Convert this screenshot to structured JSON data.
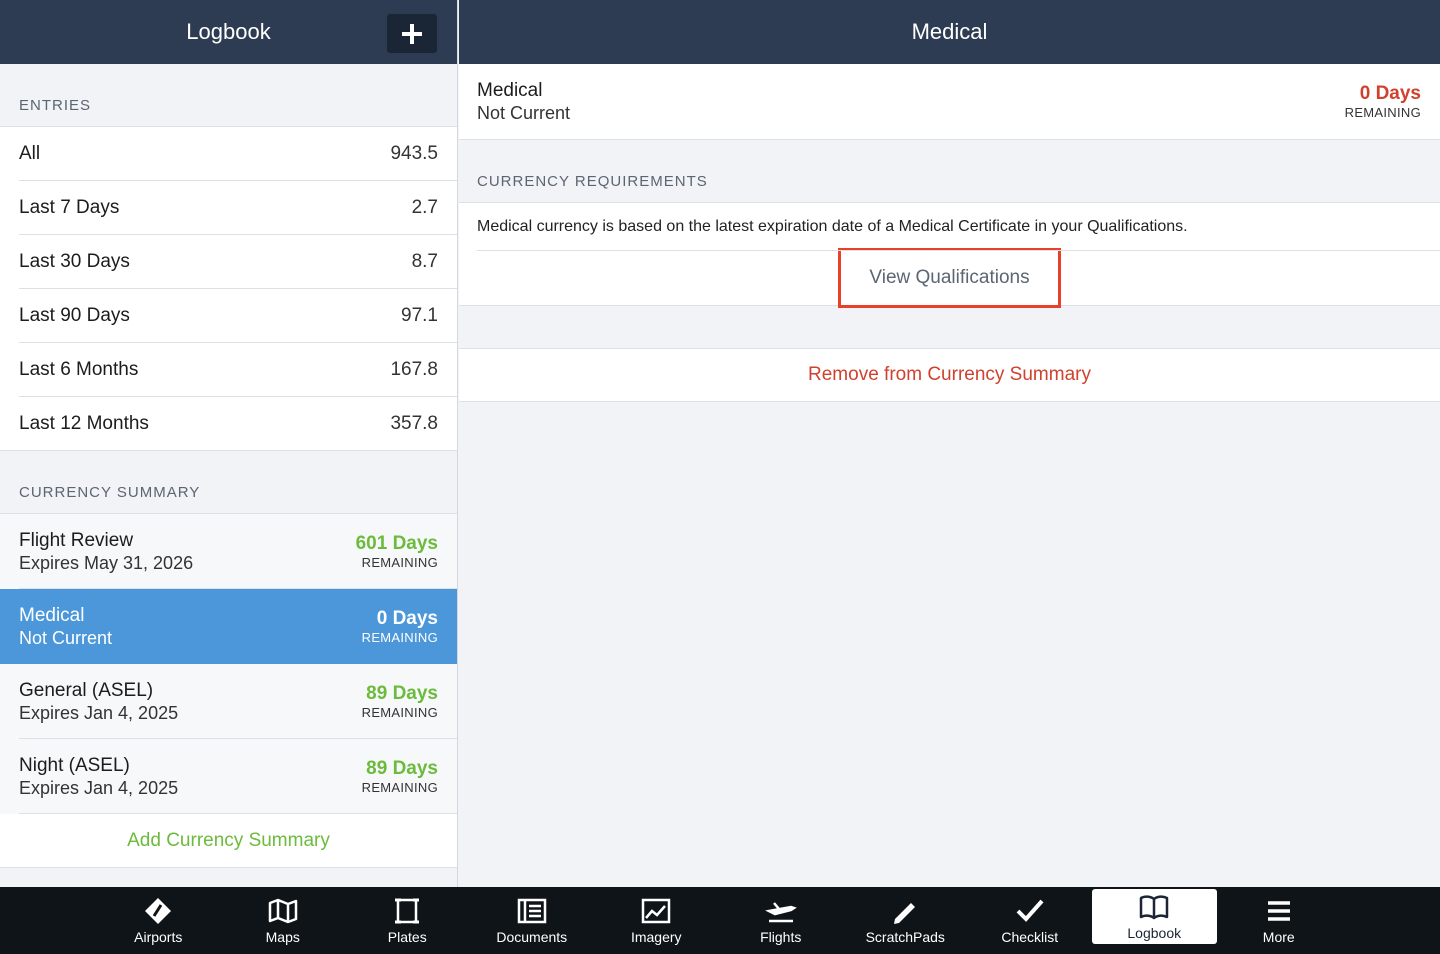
{
  "left": {
    "title": "Logbook",
    "entries_label": "ENTRIES",
    "entries": [
      {
        "label": "All",
        "value": "943.5"
      },
      {
        "label": "Last 7 Days",
        "value": "2.7"
      },
      {
        "label": "Last 30 Days",
        "value": "8.7"
      },
      {
        "label": "Last 90 Days",
        "value": "97.1"
      },
      {
        "label": "Last 6 Months",
        "value": "167.8"
      },
      {
        "label": "Last 12 Months",
        "value": "357.8"
      }
    ],
    "currency_label": "CURRENCY SUMMARY",
    "currency": [
      {
        "name": "Flight Review",
        "sub": "Expires May 31, 2026",
        "days": "601 Days",
        "rem": "REMAINING"
      },
      {
        "name": "Medical",
        "sub": "Not Current",
        "days": "0 Days",
        "rem": "REMAINING"
      },
      {
        "name": "General (ASEL)",
        "sub": "Expires Jan 4, 2025",
        "days": "89 Days",
        "rem": "REMAINING"
      },
      {
        "name": "Night (ASEL)",
        "sub": "Expires Jan 4, 2025",
        "days": "89 Days",
        "rem": "REMAINING"
      }
    ],
    "add_summary": "Add Currency Summary"
  },
  "right": {
    "title": "Medical",
    "detail": {
      "name": "Medical",
      "sub": "Not Current",
      "days": "0 Days",
      "rem": "REMAINING"
    },
    "req_label": "CURRENCY REQUIREMENTS",
    "req_text": "Medical currency is based on the latest expiration date of a Medical Certificate in your Qualifications.",
    "view_qualifications": "View Qualifications",
    "remove": "Remove from Currency Summary"
  },
  "tabs": [
    {
      "label": "Airports",
      "icon": "airports-icon"
    },
    {
      "label": "Maps",
      "icon": "maps-icon"
    },
    {
      "label": "Plates",
      "icon": "plates-icon"
    },
    {
      "label": "Documents",
      "icon": "documents-icon"
    },
    {
      "label": "Imagery",
      "icon": "imagery-icon"
    },
    {
      "label": "Flights",
      "icon": "flights-icon"
    },
    {
      "label": "ScratchPads",
      "icon": "scratchpads-icon"
    },
    {
      "label": "Checklist",
      "icon": "checklist-icon"
    },
    {
      "label": "Logbook",
      "icon": "logbook-icon"
    },
    {
      "label": "More",
      "icon": "more-icon"
    }
  ],
  "colors": {
    "header": "#2d3c52",
    "selected": "#4b97da",
    "green": "#6cbb3c",
    "red": "#d0412e",
    "highlight": "#e8402a"
  }
}
